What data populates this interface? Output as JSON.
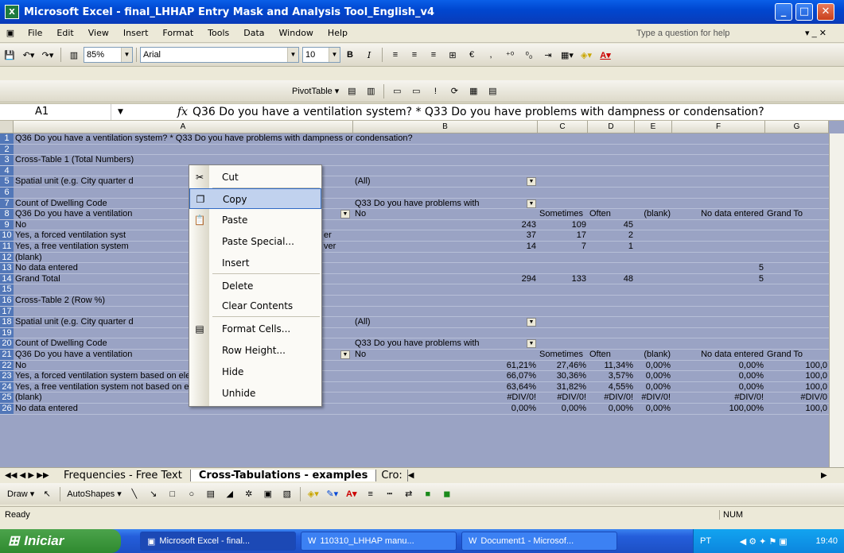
{
  "window": {
    "title": "Microsoft Excel - final_LHHAP Entry Mask and Analysis Tool_English_v4"
  },
  "menu": {
    "items": [
      "File",
      "Edit",
      "View",
      "Insert",
      "Format",
      "Tools",
      "Data",
      "Window",
      "Help"
    ],
    "help_placeholder": "Type a question for help"
  },
  "toolbar": {
    "zoom": "85%",
    "font": "Arial",
    "size": "10",
    "pivot_label": "PivotTable ▾"
  },
  "formula": {
    "namebox": "A1",
    "fx": "fx",
    "content": "Q36 Do you have a ventilation system? * Q33 Do you have problems with dampness or condensation?"
  },
  "columns": [
    "A",
    "B",
    "C",
    "D",
    "E",
    "F",
    "G"
  ],
  "rows": [
    {
      "n": "1",
      "a": "Q36 Do you have a ventilation system? * Q33 Do you have problems with dampness or condensation?",
      "b": "",
      "c": "",
      "d": "",
      "e": "",
      "f": "",
      "g": ""
    },
    {
      "n": "2",
      "a": "",
      "b": "",
      "c": "",
      "d": "",
      "e": "",
      "f": "",
      "g": ""
    },
    {
      "n": "3",
      "a": "Cross-Table 1 (Total Numbers)",
      "b": "",
      "c": "",
      "d": "",
      "e": "",
      "f": "",
      "g": ""
    },
    {
      "n": "4",
      "a": "",
      "b": "",
      "c": "",
      "d": "",
      "e": "",
      "f": "",
      "g": ""
    },
    {
      "n": "5",
      "a": "Spatial unit (e.g. City quarter d",
      "b": "(All)",
      "c": "",
      "d": "",
      "e": "",
      "f": "",
      "g": ""
    },
    {
      "n": "6",
      "a": "",
      "b": "",
      "c": "",
      "d": "",
      "e": "",
      "f": "",
      "g": ""
    },
    {
      "n": "7",
      "a": "Count of Dwelling Code",
      "b": "Q33 Do you have problems with",
      "c": "",
      "d": "",
      "e": "",
      "f": "",
      "g": ""
    },
    {
      "n": "8",
      "a": "Q36 Do you have a ventilation",
      "b": "No",
      "c": "Sometimes",
      "d": "Often",
      "e": "(blank)",
      "f": "No data entered",
      "g": "Grand To"
    },
    {
      "n": "9",
      "a": "No",
      "b": "243",
      "c": "109",
      "d": "45",
      "e": "",
      "f": "",
      "g": ""
    },
    {
      "n": "10",
      "a": "Yes, a forced ventilation syst",
      "b": "37",
      "c": "17",
      "d": "2",
      "e": "",
      "f": "",
      "g": ""
    },
    {
      "n": "11",
      "a": "Yes, a free ventilation system",
      "b": "14",
      "c": "7",
      "d": "1",
      "e": "",
      "f": "",
      "g": ""
    },
    {
      "n": "12",
      "a": "(blank)",
      "b": "",
      "c": "",
      "d": "",
      "e": "",
      "f": "",
      "g": ""
    },
    {
      "n": "13",
      "a": "No data entered",
      "b": "",
      "c": "",
      "d": "",
      "e": "",
      "f": "5",
      "g": ""
    },
    {
      "n": "14",
      "a": "Grand Total",
      "b": "294",
      "c": "133",
      "d": "48",
      "e": "",
      "f": "5",
      "g": ""
    },
    {
      "n": "15",
      "a": "",
      "b": "",
      "c": "",
      "d": "",
      "e": "",
      "f": "",
      "g": ""
    },
    {
      "n": "16",
      "a": "Cross-Table 2 (Row %)",
      "b": "",
      "c": "",
      "d": "",
      "e": "",
      "f": "",
      "g": ""
    },
    {
      "n": "17",
      "a": "",
      "b": "",
      "c": "",
      "d": "",
      "e": "",
      "f": "",
      "g": ""
    },
    {
      "n": "18",
      "a": "Spatial unit (e.g. City quarter d",
      "b": "(All)",
      "c": "",
      "d": "",
      "e": "",
      "f": "",
      "g": ""
    },
    {
      "n": "19",
      "a": "",
      "b": "",
      "c": "",
      "d": "",
      "e": "",
      "f": "",
      "g": ""
    },
    {
      "n": "20",
      "a": "Count of Dwelling Code",
      "b": "Q33 Do you have problems with",
      "c": "",
      "d": "",
      "e": "",
      "f": "",
      "g": ""
    },
    {
      "n": "21",
      "a": "Q36 Do you have a ventilation",
      "b": "No",
      "c": "Sometimes",
      "d": "Often",
      "e": "(blank)",
      "f": "No data entered",
      "g": "Grand To"
    },
    {
      "n": "22",
      "a": "No",
      "b": "61,21%",
      "c": "27,46%",
      "d": "11,34%",
      "e": "0,00%",
      "f": "0,00%",
      "g": "100,0"
    },
    {
      "n": "23",
      "a": "Yes, a forced ventilation system based on electric power",
      "b": "66,07%",
      "c": "30,36%",
      "d": "3,57%",
      "e": "0,00%",
      "f": "0,00%",
      "g": "100,0"
    },
    {
      "n": "24",
      "a": "Yes, a free ventilation system not based on electric power",
      "b": "63,64%",
      "c": "31,82%",
      "d": "4,55%",
      "e": "0,00%",
      "f": "0,00%",
      "g": "100,0"
    },
    {
      "n": "25",
      "a": "(blank)",
      "b": "#DIV/0!",
      "c": "#DIV/0!",
      "d": "#DIV/0!",
      "e": "#DIV/0!",
      "f": "#DIV/0!",
      "g": "#DIV/0"
    },
    {
      "n": "26",
      "a": "No data entered",
      "b": "0,00%",
      "c": "0,00%",
      "d": "0,00%",
      "e": "0,00%",
      "f": "100,00%",
      "g": "100,0"
    }
  ],
  "hidden_text": {
    "r10b": "er",
    "r11b": "ver"
  },
  "context_menu": [
    {
      "label": "Cut",
      "icon": "scissors-icon",
      "glyph": "✂"
    },
    {
      "label": "Copy",
      "icon": "copy-icon",
      "glyph": "❐"
    },
    {
      "label": "Paste",
      "icon": "paste-icon",
      "glyph": "📋"
    },
    {
      "label": "Paste Special...",
      "icon": "",
      "glyph": ""
    },
    {
      "label": "Insert",
      "icon": "",
      "glyph": ""
    },
    {
      "label": "Delete",
      "icon": "",
      "glyph": ""
    },
    {
      "label": "Clear Contents",
      "icon": "",
      "glyph": ""
    },
    {
      "label": "Format Cells...",
      "icon": "format-cells-icon",
      "glyph": "▤"
    },
    {
      "label": "Row Height...",
      "icon": "",
      "glyph": ""
    },
    {
      "label": "Hide",
      "icon": "",
      "glyph": ""
    },
    {
      "label": "Unhide",
      "icon": "",
      "glyph": ""
    }
  ],
  "sheets": {
    "tab1": "Frequencies - Free Text",
    "tab2": "Cross-Tabulations - examples",
    "tab3": "Cro:"
  },
  "drawbar": {
    "draw": "Draw ▾",
    "autoshapes": "AutoShapes ▾"
  },
  "status": {
    "left": "Ready",
    "num": "NUM"
  },
  "taskbar": {
    "start": "Iniciar",
    "tasks": [
      "Microsoft Excel - final...",
      "110310_LHHAP manu...",
      "Document1 - Microsof..."
    ],
    "lang": "PT",
    "clock": "19:40"
  }
}
